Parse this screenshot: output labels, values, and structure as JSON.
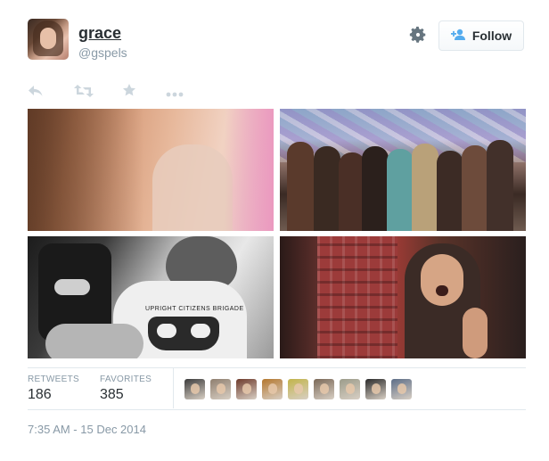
{
  "user": {
    "display_name": "grace",
    "handle": "@gspels",
    "avatar_icon": "profile-photo"
  },
  "header": {
    "settings_icon": "gear-icon",
    "follow_label": "Follow",
    "follow_icon": "add-user-icon"
  },
  "actions": [
    {
      "name": "reply",
      "icon": "reply-icon"
    },
    {
      "name": "retweet",
      "icon": "retweet-icon"
    },
    {
      "name": "favorite",
      "icon": "star-icon"
    },
    {
      "name": "more",
      "icon": "more-icon"
    }
  ],
  "photos": [
    {
      "name": "photo-selfie"
    },
    {
      "name": "photo-group"
    },
    {
      "name": "photo-car-shirt",
      "shirt_text": "UPRIGHT CITIZENS BRIGADE"
    },
    {
      "name": "photo-doorway"
    }
  ],
  "stats": {
    "retweets_label": "RETWEETS",
    "retweets_value": "186",
    "favorites_label": "FAVORITES",
    "favorites_value": "385"
  },
  "favoriters": [
    {
      "color": "#3c3c3c"
    },
    {
      "color": "#8f7f6f"
    },
    {
      "color": "#6e3a2b"
    },
    {
      "color": "#b4772e"
    },
    {
      "color": "#c2b44a"
    },
    {
      "color": "#7a6857"
    },
    {
      "color": "#9c9c8a"
    },
    {
      "color": "#2b2b2b"
    },
    {
      "color": "#5c6d87"
    }
  ],
  "timestamp": "7:35 AM - 15 Dec 2014",
  "colors": {
    "text": "#292f33",
    "muted": "#8899a6",
    "icon": "#ccd6dd",
    "border": "#e1e8ed",
    "follow_icon": "#55acee"
  }
}
